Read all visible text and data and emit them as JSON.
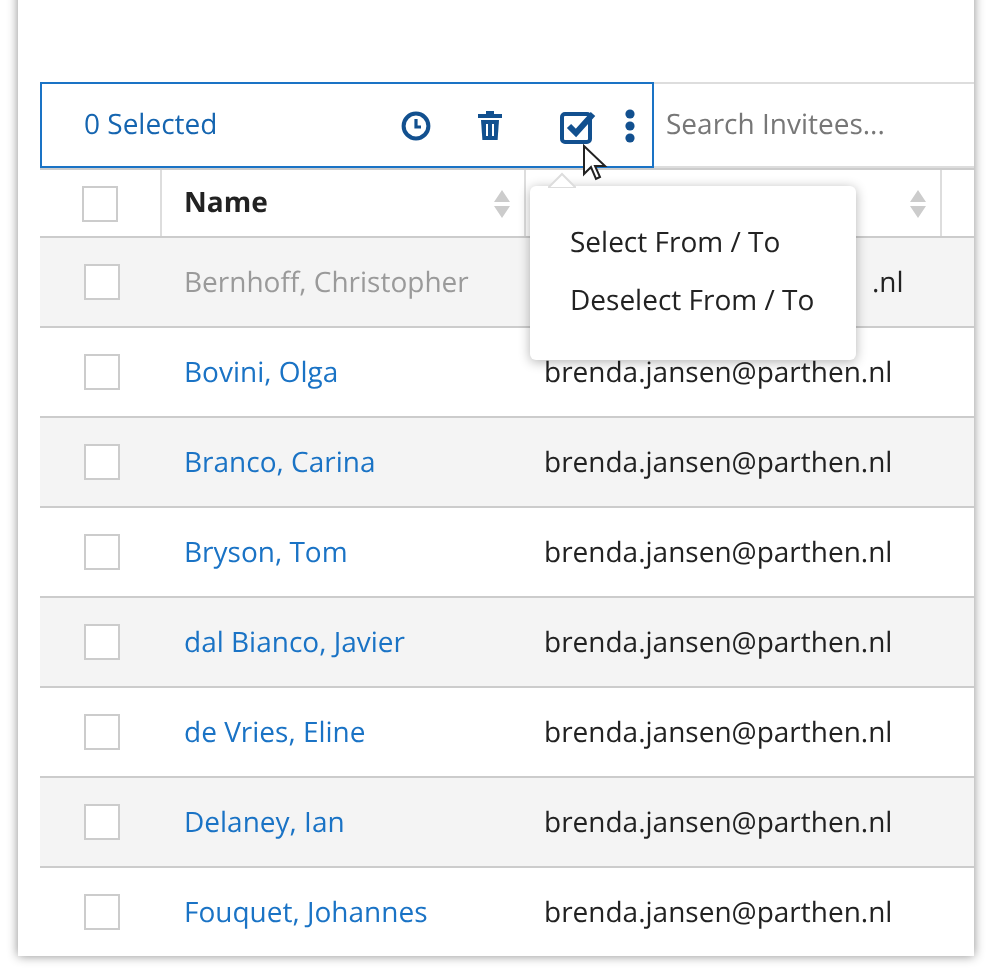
{
  "toolbar": {
    "selected_count": "0 Selected",
    "search": {
      "placeholder": "Search Invitees..."
    }
  },
  "table": {
    "all_checked": false,
    "columns": [
      {
        "label": "Name",
        "sortable": true
      },
      {
        "sortable": true
      }
    ],
    "rows": [
      {
        "name": "Bernhoff, Christopher",
        "email": ".nl",
        "disabled": true,
        "covered": true,
        "checked": false
      },
      {
        "name": "Bovini, Olga",
        "email": "brenda.jansen@parthen.nl",
        "disabled": false,
        "covered": false,
        "checked": false
      },
      {
        "name": "Branco, Carina",
        "email": "brenda.jansen@parthen.nl",
        "disabled": false,
        "covered": false,
        "checked": false
      },
      {
        "name": "Bryson, Tom",
        "email": "brenda.jansen@parthen.nl",
        "disabled": false,
        "covered": false,
        "checked": false
      },
      {
        "name": "dal Bianco, Javier",
        "email": "brenda.jansen@parthen.nl",
        "disabled": false,
        "covered": false,
        "checked": false
      },
      {
        "name": "de Vries, Eline",
        "email": "brenda.jansen@parthen.nl",
        "disabled": false,
        "covered": false,
        "checked": false
      },
      {
        "name": "Delaney, Ian",
        "email": "brenda.jansen@parthen.nl",
        "disabled": false,
        "covered": false,
        "checked": false
      },
      {
        "name": "Fouquet, Johannes",
        "email": "brenda.jansen@parthen.nl",
        "disabled": false,
        "covered": false,
        "checked": false
      }
    ]
  },
  "menu": {
    "items": [
      "Select From / To",
      "Deselect From / To"
    ]
  }
}
